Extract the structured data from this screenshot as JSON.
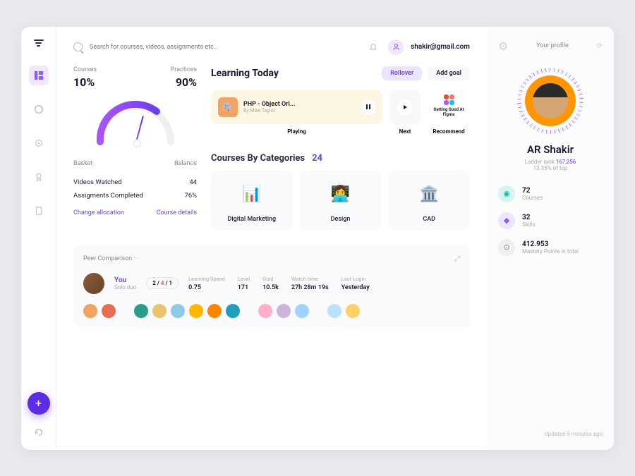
{
  "search": {
    "placeholder": "Search for courses, videos, assignments etc.."
  },
  "user": {
    "email": "shakir@gmail.com"
  },
  "gauge": {
    "courses_label": "Courses",
    "courses_pct": "10%",
    "practices_label": "Practices",
    "practices_pct": "90%",
    "basket_label": "Basket",
    "balance_label": "Balance",
    "stats": [
      {
        "label": "Videos Watched",
        "value": "44"
      },
      {
        "label": "Assigments Completed",
        "value": "76%"
      }
    ],
    "change_link": "Change allocation",
    "details_link": "Course details"
  },
  "learning": {
    "title": "Learning Today",
    "rollover": "Rollover",
    "add_goal": "Add goal",
    "playing": {
      "title": "PHP - Object Ori...",
      "author": "By Mike Taylor",
      "label": "Playing"
    },
    "next": {
      "label": "Next"
    },
    "recommend": {
      "title": "Getting Good At Figma",
      "label": "Recommend"
    }
  },
  "categories": {
    "title": "Courses By Categories",
    "count": "24",
    "items": [
      {
        "name": "Digital Marketing"
      },
      {
        "name": "Design"
      },
      {
        "name": "CAD"
      }
    ]
  },
  "peer": {
    "title": "Peer Comparison",
    "you": "You",
    "solo": "Solo duo",
    "badge_a": "2",
    "badge_b": "4",
    "badge_c": "1",
    "stats": [
      {
        "label": "Learning Speed",
        "value": "0.75"
      },
      {
        "label": "Level",
        "value": "171"
      },
      {
        "label": "Gold",
        "value": "10.5k"
      },
      {
        "label": "Watch time",
        "value": "27h 28m 19s"
      },
      {
        "label": "Last Login",
        "value": "Yesterday"
      }
    ]
  },
  "profile": {
    "label": "Your profile",
    "name": "AR Shakir",
    "ladder_label": "Ladder rank",
    "ladder_rank": "167,256",
    "top": "13.35% of top",
    "stats": [
      {
        "value": "72",
        "label": "Courses"
      },
      {
        "value": "32",
        "label": "Skills"
      },
      {
        "value": "412.953",
        "label": "Mastery Points in total"
      }
    ],
    "updated": "Updated 5 minutes ago"
  }
}
